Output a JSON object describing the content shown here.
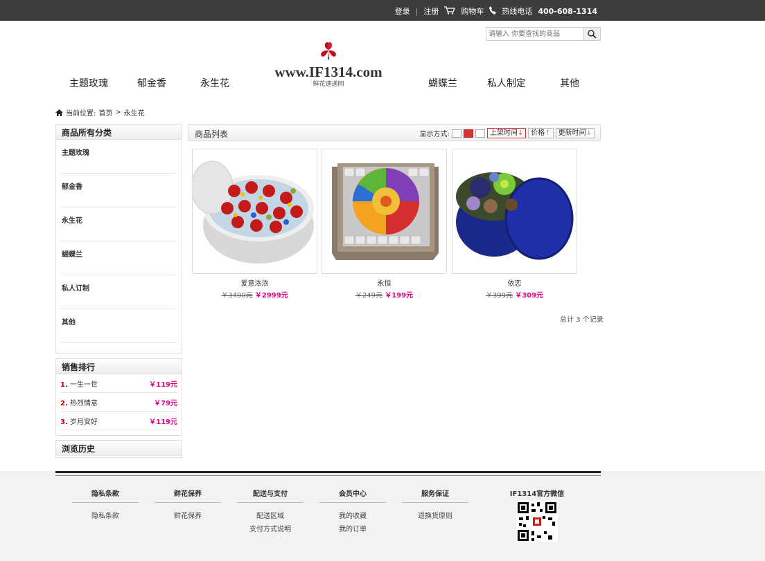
{
  "topbar": {
    "login": "登录",
    "register": "注册",
    "cart": "购物车",
    "hotline_label": "热线电话",
    "hotline": "400-608-1314"
  },
  "search": {
    "placeholder": "请输入 你要查找的商品"
  },
  "nav": [
    "主题玫瑰",
    "郁金香",
    "永生花",
    "蝴蝶兰",
    "私人制定",
    "其他"
  ],
  "logo": {
    "url": "www.IF1314.com",
    "subtitle": "鲜花速递网"
  },
  "breadcrumb": {
    "prefix": "当前位置:",
    "home": "首页",
    "sep": ">",
    "current": "永生花"
  },
  "categories": {
    "title": "商品所有分类",
    "items": [
      "主题玫瑰",
      "郁金香",
      "永生花",
      "蝴蝶兰",
      "私人订制",
      "其他"
    ]
  },
  "ranking": {
    "title": "销售排行",
    "items": [
      {
        "num": "1.",
        "name": "一生一世",
        "price": "￥119元"
      },
      {
        "num": "2.",
        "name": "热烈情意",
        "price": "￥79元"
      },
      {
        "num": "3.",
        "name": "岁月安好",
        "price": "￥119元"
      }
    ]
  },
  "history": {
    "title": "浏览历史"
  },
  "list": {
    "title": "商品列表",
    "display_label": "显示方式:",
    "sort_shelf": "上架时间",
    "sort_price": "价格",
    "sort_update": "更新时间"
  },
  "products": [
    {
      "name": "爱意浓浓",
      "old": "￥3490元",
      "new": "￥2999元"
    },
    {
      "name": "永恒",
      "old": "￥249元",
      "new": "￥199元"
    },
    {
      "name": "依恋",
      "old": "￥399元",
      "new": "￥309元"
    }
  ],
  "total": "总计 3 个记录",
  "footer": {
    "columns": [
      {
        "title": "隐私条款",
        "links": [
          "隐私条款"
        ]
      },
      {
        "title": "鲜花保养",
        "links": [
          "鲜花保养"
        ]
      },
      {
        "title": "配送与支付",
        "links": [
          "配送区域",
          "支付方式说明"
        ]
      },
      {
        "title": "会员中心",
        "links": [
          "我的收藏",
          "我的订单"
        ]
      },
      {
        "title": "服务保证",
        "links": [
          "退换货原则"
        ]
      }
    ],
    "wechat": "IF1314官方微信"
  },
  "colors": {
    "accent": "#e4007f",
    "logo_red": "#c0101f",
    "topbar": "#3d3d3d"
  }
}
